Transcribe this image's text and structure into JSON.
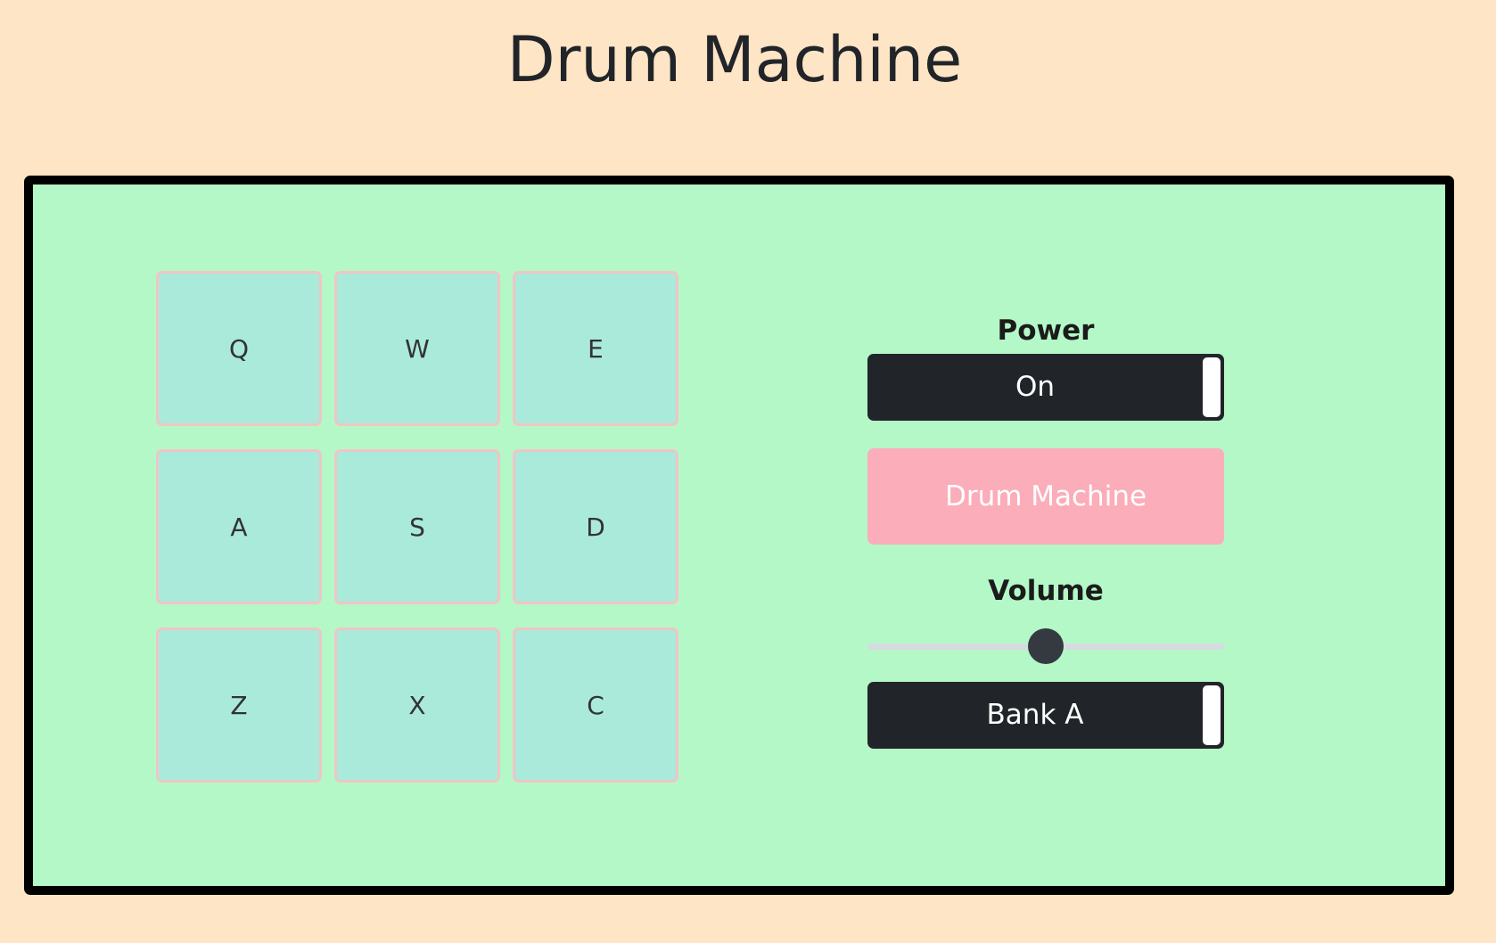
{
  "title": "Drum Machine",
  "pads": [
    {
      "key": "Q"
    },
    {
      "key": "W"
    },
    {
      "key": "E"
    },
    {
      "key": "A"
    },
    {
      "key": "S"
    },
    {
      "key": "D"
    },
    {
      "key": "Z"
    },
    {
      "key": "X"
    },
    {
      "key": "C"
    }
  ],
  "controls": {
    "power_label": "Power",
    "power_state": "On",
    "display_text": "Drum Machine",
    "volume_label": "Volume",
    "volume_value": 0.5,
    "bank_state": "Bank A"
  },
  "colors": {
    "background": "#fde5c5",
    "machine_bg": "#b4f8c8",
    "pad_bg": "#aaeadb",
    "pad_border": "#f0c5c5",
    "toggle_bg": "#212529",
    "display_bg": "#fbadba",
    "slider_thumb": "#343a40"
  }
}
